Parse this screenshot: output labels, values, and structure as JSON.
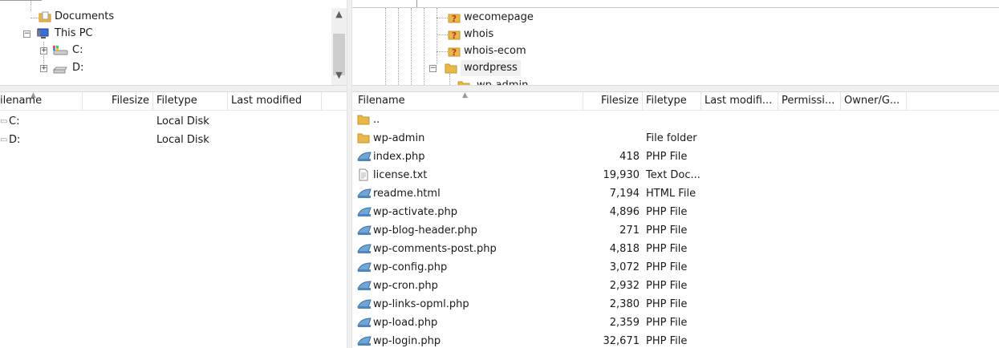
{
  "local_tree": {
    "items": [
      {
        "label": "Documents",
        "icon": "folder-icon"
      },
      {
        "label": "This PC",
        "icon": "computer-icon"
      },
      {
        "label": "C:",
        "icon": "drive-c-icon"
      },
      {
        "label": "D:",
        "icon": "drive-d-icon"
      }
    ]
  },
  "remote_tree": {
    "items": [
      {
        "label": "wecomepage",
        "icon": "unknown-folder-icon"
      },
      {
        "label": "whois",
        "icon": "unknown-folder-icon"
      },
      {
        "label": "whois-ecom",
        "icon": "unknown-folder-icon"
      },
      {
        "label": "wordpress",
        "icon": "folder-icon"
      },
      {
        "label": "wp-admin",
        "icon": "folder-icon"
      }
    ]
  },
  "local_list": {
    "headers": [
      "ilename",
      "Filesize",
      "Filetype",
      "Last modified"
    ],
    "rows": [
      {
        "name": "C:",
        "size": "",
        "type": "Local Disk",
        "modified": ""
      },
      {
        "name": "D:",
        "size": "",
        "type": "Local Disk",
        "modified": ""
      }
    ]
  },
  "remote_list": {
    "headers": [
      "Filename",
      "Filesize",
      "Filetype",
      "Last modifi...",
      "Permissi...",
      "Owner/G..."
    ],
    "rows": [
      {
        "name": "..",
        "size": "",
        "type": "",
        "icon": "folder-icon"
      },
      {
        "name": "wp-admin",
        "size": "",
        "type": "File folder",
        "icon": "folder-icon"
      },
      {
        "name": "index.php",
        "size": "418",
        "type": "PHP File",
        "icon": "php-file-icon"
      },
      {
        "name": "license.txt",
        "size": "19,930",
        "type": "Text Doc...",
        "icon": "text-file-icon"
      },
      {
        "name": "readme.html",
        "size": "7,194",
        "type": "HTML File",
        "icon": "php-file-icon"
      },
      {
        "name": "wp-activate.php",
        "size": "4,896",
        "type": "PHP File",
        "icon": "php-file-icon"
      },
      {
        "name": "wp-blog-header.php",
        "size": "271",
        "type": "PHP File",
        "icon": "php-file-icon"
      },
      {
        "name": "wp-comments-post.php",
        "size": "4,818",
        "type": "PHP File",
        "icon": "php-file-icon"
      },
      {
        "name": "wp-config.php",
        "size": "3,072",
        "type": "PHP File",
        "icon": "php-file-icon"
      },
      {
        "name": "wp-cron.php",
        "size": "2,932",
        "type": "PHP File",
        "icon": "php-file-icon"
      },
      {
        "name": "wp-links-opml.php",
        "size": "2,380",
        "type": "PHP File",
        "icon": "php-file-icon"
      },
      {
        "name": "wp-load.php",
        "size": "2,359",
        "type": "PHP File",
        "icon": "php-file-icon"
      },
      {
        "name": "wp-login.php",
        "size": "32,671",
        "type": "PHP File",
        "icon": "php-file-icon"
      }
    ]
  },
  "colors": {
    "folder": "#e8b94a",
    "folder_dark": "#c99424",
    "unknown_badge": "#c0392b",
    "selection": "#f0f0f0"
  }
}
